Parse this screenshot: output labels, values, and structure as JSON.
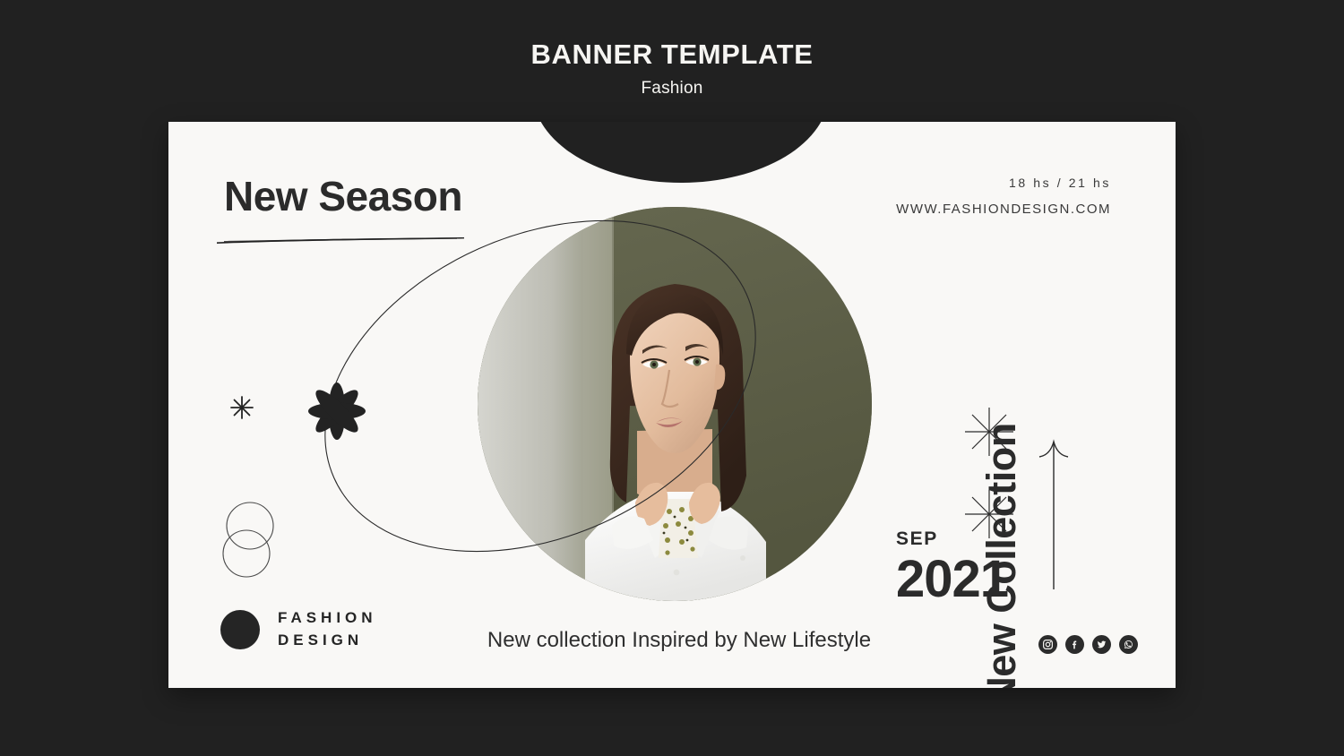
{
  "header": {
    "title": "BANNER TEMPLATE",
    "subtitle": "Fashion"
  },
  "card": {
    "headline": "New Season",
    "info": {
      "hours": "18 hs / 21 hs",
      "website": "WWW.FASHIONDESIGN.COM"
    },
    "vertical_label": "New Collection",
    "date": {
      "month": "SEP",
      "year": "2021"
    },
    "logo": {
      "line1": "FASHION",
      "line2": "DESIGN"
    },
    "tagline": "New collection Inspired by New Lifestyle",
    "socials": [
      {
        "name": "instagram-icon"
      },
      {
        "name": "facebook-icon"
      },
      {
        "name": "twitter-icon"
      },
      {
        "name": "whatsapp-icon"
      }
    ],
    "decorations": [
      {
        "name": "asterisk-small-icon"
      },
      {
        "name": "flower-asterisk-icon"
      },
      {
        "name": "overlapping-circles-icon"
      },
      {
        "name": "starburst-icon"
      },
      {
        "name": "starburst-icon"
      },
      {
        "name": "up-arrow-icon"
      },
      {
        "name": "brush-stroke-underline"
      },
      {
        "name": "orbit-ellipse-outline"
      }
    ],
    "photo": {
      "alt": "Woman in white shirt adjusting patterned collar on olive green background"
    }
  },
  "colors": {
    "page_background": "#212121",
    "card_background": "#f9f8f6",
    "ink": "#2b2b2b",
    "photo_backdrop": "#5d6049",
    "photo_wall": "#c9c9c2",
    "skin": "#e8c4a8",
    "hair": "#3d2a20",
    "shirt": "#fbfbfa",
    "lips": "#c08278"
  }
}
